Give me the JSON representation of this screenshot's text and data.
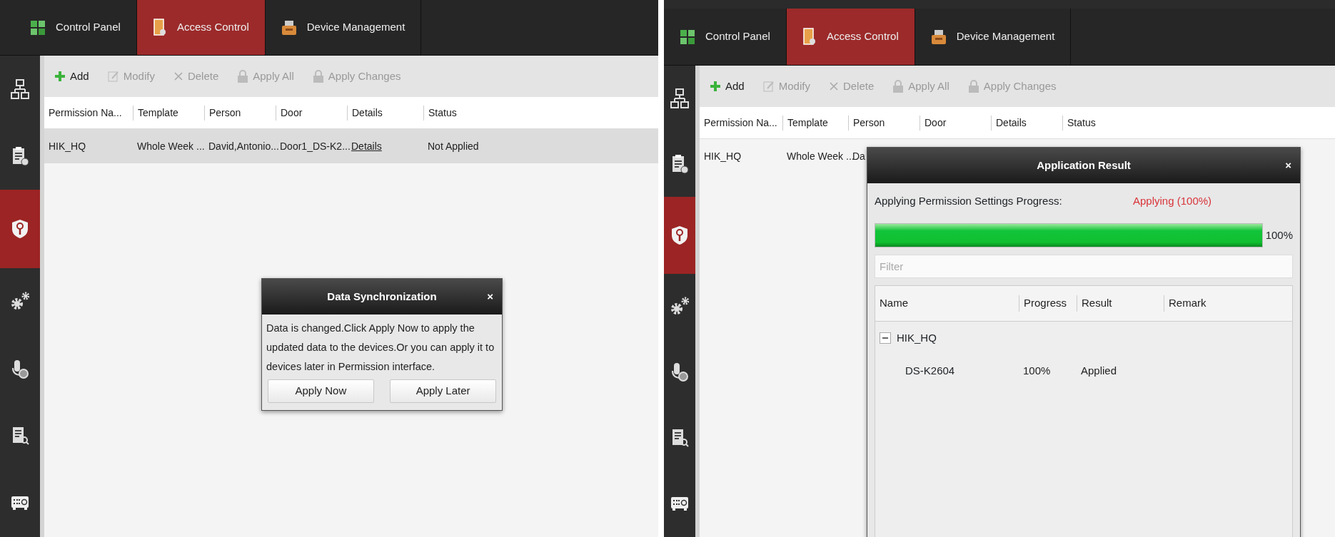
{
  "panels": [
    {
      "tabs": [
        {
          "label": "Control Panel",
          "kind": "tiles",
          "selected": false
        },
        {
          "label": "Access Control",
          "kind": "door",
          "selected": true
        },
        {
          "label": "Device Management",
          "kind": "device",
          "selected": false
        }
      ],
      "sidebar": [
        {
          "kind": "network",
          "selected": false
        },
        {
          "kind": "clipboard",
          "selected": false
        },
        {
          "kind": "shield",
          "selected": true
        },
        {
          "kind": "gears",
          "selected": false
        },
        {
          "kind": "mic",
          "selected": false
        },
        {
          "kind": "search-doc",
          "selected": false
        },
        {
          "kind": "recorder",
          "selected": false
        }
      ],
      "toolbar": [
        {
          "label": "Add",
          "kind": "add",
          "disabled": false
        },
        {
          "label": "Modify",
          "kind": "edit",
          "disabled": true
        },
        {
          "label": "Delete",
          "kind": "delete",
          "disabled": true
        },
        {
          "label": "Apply All",
          "kind": "lock",
          "disabled": true
        },
        {
          "label": "Apply Changes",
          "kind": "lock",
          "disabled": true
        }
      ],
      "table": {
        "columns": [
          "Permission Na...",
          "Template",
          "Person",
          "Door",
          "Details",
          "Status"
        ],
        "rows": [
          {
            "selected": true,
            "cells": [
              {
                "text": "HIK_HQ",
                "kind": "text"
              },
              {
                "text": "Whole Week ...",
                "kind": "text"
              },
              {
                "text": "David,Antonio...",
                "kind": "text"
              },
              {
                "text": "Door1_DS-K2...",
                "kind": "text"
              },
              {
                "text": "Details",
                "kind": "link"
              },
              {
                "text": "Not Applied",
                "kind": "text"
              }
            ]
          }
        ]
      },
      "dialog": {
        "kind": "sync",
        "title": "Data Synchronization",
        "close": "×",
        "message": "Data is changed.Click Apply Now to apply the updated data to the devices.Or you can apply it to devices later in Permission interface.",
        "buttons": [
          "Apply Now",
          "Apply Later"
        ]
      }
    },
    {
      "tabs": [
        {
          "label": "Control Panel",
          "kind": "tiles",
          "selected": false
        },
        {
          "label": "Access Control",
          "kind": "door",
          "selected": true
        },
        {
          "label": "Device Management",
          "kind": "device",
          "selected": false
        }
      ],
      "sidebar": [
        {
          "kind": "network",
          "selected": false
        },
        {
          "kind": "clipboard",
          "selected": false
        },
        {
          "kind": "shield",
          "selected": true
        },
        {
          "kind": "gears",
          "selected": false
        },
        {
          "kind": "mic",
          "selected": false
        },
        {
          "kind": "search-doc",
          "selected": false
        },
        {
          "kind": "recorder",
          "selected": false
        }
      ],
      "toolbar": [
        {
          "label": "Add",
          "kind": "add",
          "disabled": false
        },
        {
          "label": "Modify",
          "kind": "edit",
          "disabled": true
        },
        {
          "label": "Delete",
          "kind": "delete",
          "disabled": true
        },
        {
          "label": "Apply All",
          "kind": "lock",
          "disabled": true
        },
        {
          "label": "Apply Changes",
          "kind": "lock",
          "disabled": true
        }
      ],
      "table": {
        "columns": [
          "Permission Na...",
          "Template",
          "Person",
          "Door",
          "Details",
          "Status"
        ],
        "rows": [
          {
            "selected": false,
            "cells": [
              {
                "text": "HIK_HQ",
                "kind": "text"
              },
              {
                "text": "Whole Week ...",
                "kind": "text"
              },
              {
                "text": "Da",
                "kind": "text"
              }
            ]
          }
        ]
      },
      "dialog": {
        "kind": "result",
        "title": "Application Result",
        "close": "×",
        "progress_label": "Applying Permission Settings Progress:",
        "status": "Applying (100%)",
        "level": 1,
        "reading": "100%",
        "filter": {
          "placeholder": "Filter"
        },
        "columns": [
          "Name",
          "Progress",
          "Result",
          "Remark"
        ],
        "tree": [
          {
            "name": "HIK_HQ",
            "expanded": true,
            "children": [
              {
                "name": "DS-K2604",
                "progress": "100%",
                "result": "Applied"
              }
            ]
          }
        ]
      }
    }
  ]
}
